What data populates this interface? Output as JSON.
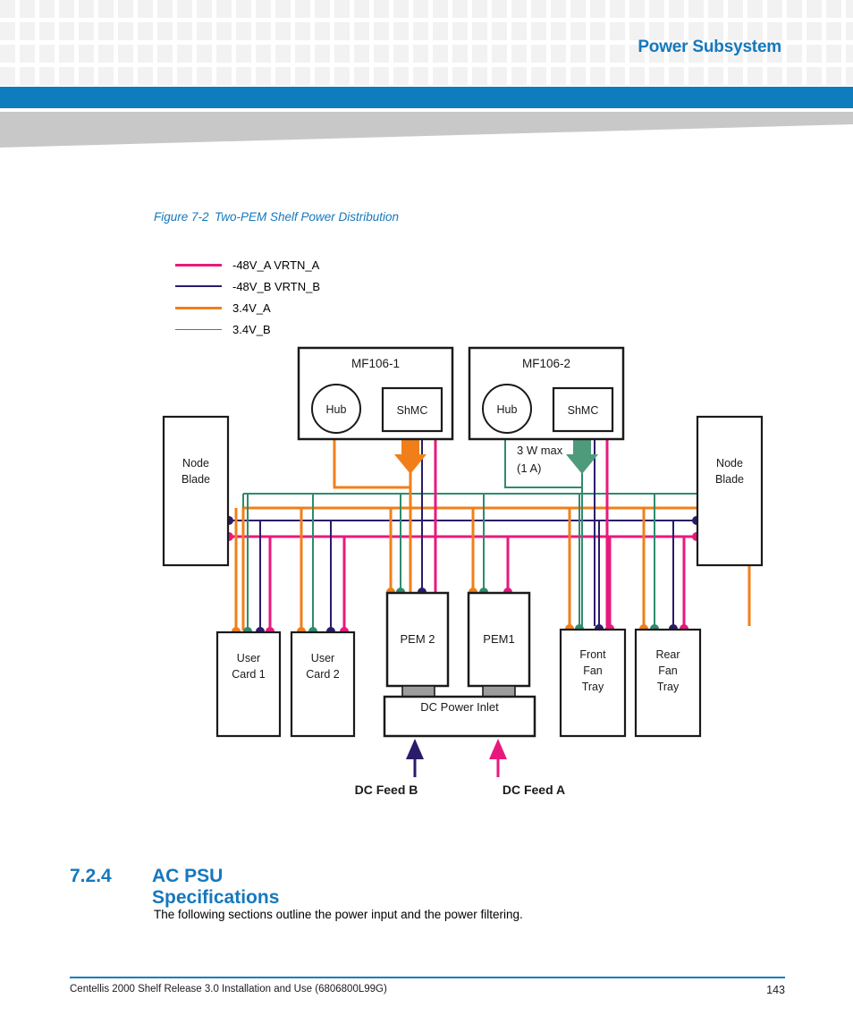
{
  "header": {
    "title": "Power Subsystem"
  },
  "figure": {
    "number": "Figure 7-2",
    "caption": "Two-PEM Shelf Power Distribution"
  },
  "legend": {
    "items": [
      {
        "label": "-48V_A VRTN_A",
        "color": "#E8197D"
      },
      {
        "label": "-48V_B VRTN_B",
        "color": "#2B1B6B"
      },
      {
        "label": "3.4V_A",
        "color": "#F07F1A"
      },
      {
        "label": "3.4V_B",
        "color": "#2F8B6C"
      }
    ]
  },
  "diagram": {
    "modules": [
      {
        "id": "mf106-1",
        "label": "MF106-1",
        "hub": "Hub",
        "shmc": "ShMC"
      },
      {
        "id": "mf106-2",
        "label": "MF106-2",
        "hub": "Hub",
        "shmc": "ShMC"
      }
    ],
    "annotation": {
      "line1": "3 W max",
      "line2": "(1 A)"
    },
    "node_blade_left": "Node\nBlade",
    "node_blade_left_l1": "Node",
    "node_blade_left_l2": "Blade",
    "node_blade_right_l1": "Node",
    "node_blade_right_l2": "Blade",
    "user_card_1_l1": "User",
    "user_card_1_l2": "Card 1",
    "user_card_2_l1": "User",
    "user_card_2_l2": "Card 2",
    "pem2": "PEM 2",
    "pem1": "PEM1",
    "dc_power_inlet": "DC Power Inlet",
    "front_fan_l1": "Front",
    "front_fan_l2": "Fan",
    "front_fan_l3": "Tray",
    "rear_fan_l1": "Rear",
    "rear_fan_l2": "Fan",
    "rear_fan_l3": "Tray",
    "dc_feed_b": "DC Feed B",
    "dc_feed_a": "DC Feed A"
  },
  "section": {
    "number": "7.2.4",
    "title": "AC PSU Specifications",
    "body": "The following sections outline the power input and the power filtering."
  },
  "footer": {
    "text": "Centellis 2000 Shelf Release 3.0 Installation and Use (6806800L99G)",
    "page": "143"
  },
  "colors": {
    "brand_blue": "#1578bd",
    "bar_blue": "#0f7dbd",
    "pink": "#E8197D",
    "navy": "#2B1B6B",
    "orange": "#F07F1A",
    "green": "#2F8B6C",
    "gray": "#c8c8c8"
  }
}
